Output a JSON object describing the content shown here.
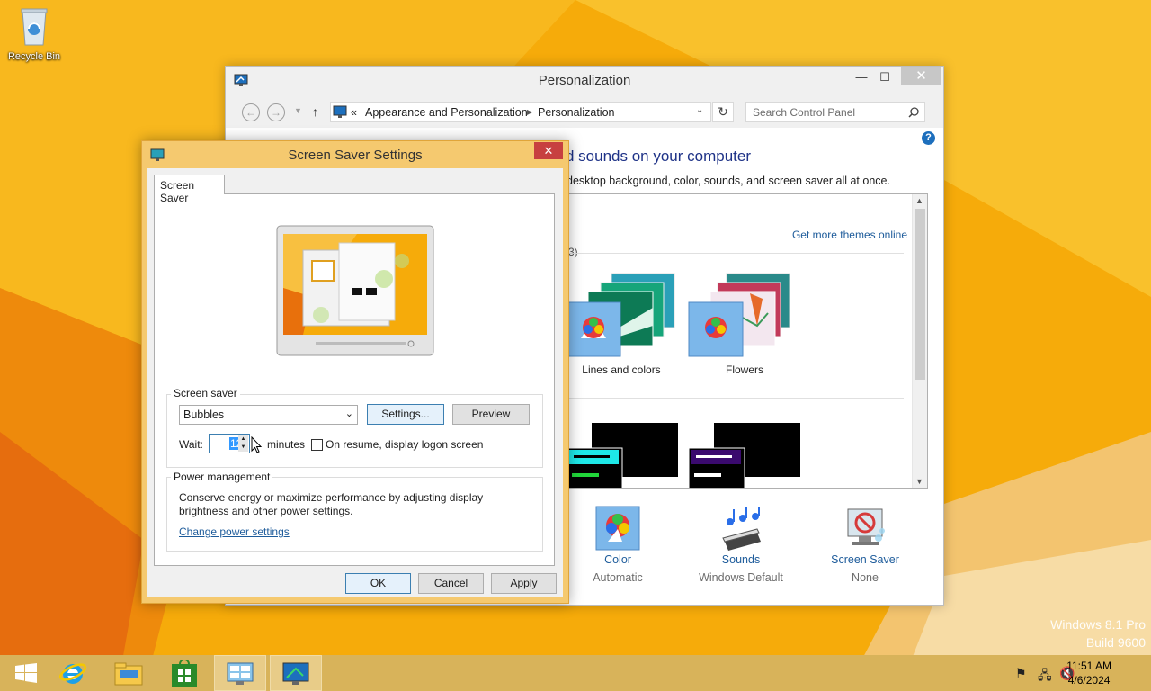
{
  "desktop": {
    "icons": [
      {
        "label": "Recycle Bin"
      }
    ],
    "watermark": {
      "line1": "Windows 8.1 Pro",
      "line2": "Build 9600"
    }
  },
  "personalization": {
    "title": "Personalization",
    "address": {
      "root": "«",
      "crumb1": "Appearance and Personalization",
      "crumb2": "Personalization"
    },
    "search_placeholder": "Search Control Panel",
    "heading": "d sounds on your computer",
    "subheading": "desktop background, color, sounds, and screen saver all at once.",
    "get_more_link": "Get more themes online",
    "group_count": "(3)",
    "themes": [
      {
        "name": "Lines and colors"
      },
      {
        "name": "Flowers"
      }
    ],
    "bottom": [
      {
        "label": "Color",
        "value": "Automatic",
        "icon": "palette-icon"
      },
      {
        "label": "Sounds",
        "value": "Windows Default",
        "icon": "music-notes-icon"
      },
      {
        "label": "Screen Saver",
        "value": "None",
        "icon": "screen-saver-icon"
      }
    ]
  },
  "screensaver": {
    "title": "Screen Saver Settings",
    "tab": "Screen Saver",
    "screen_saver_group": "Screen saver",
    "selected": "Bubbles",
    "settings_btn": "Settings...",
    "preview_btn": "Preview",
    "wait_label": "Wait:",
    "wait_value": "12",
    "minutes_label": "minutes",
    "resume_label": "On resume, display logon screen",
    "resume_checked": false,
    "power_group": "Power management",
    "power_text_1": "Conserve energy or maximize performance by adjusting display",
    "power_text_2": "brightness and other power settings.",
    "power_link": "Change power settings",
    "ok": "OK",
    "cancel": "Cancel",
    "apply": "Apply"
  },
  "taskbar": {
    "items": [
      "windows-logo-icon",
      "internet-explorer-icon",
      "file-explorer-icon",
      "store-icon",
      "control-panel-icon",
      "personalization-icon"
    ],
    "time": "11:51 AM",
    "date": "4/6/2024"
  }
}
